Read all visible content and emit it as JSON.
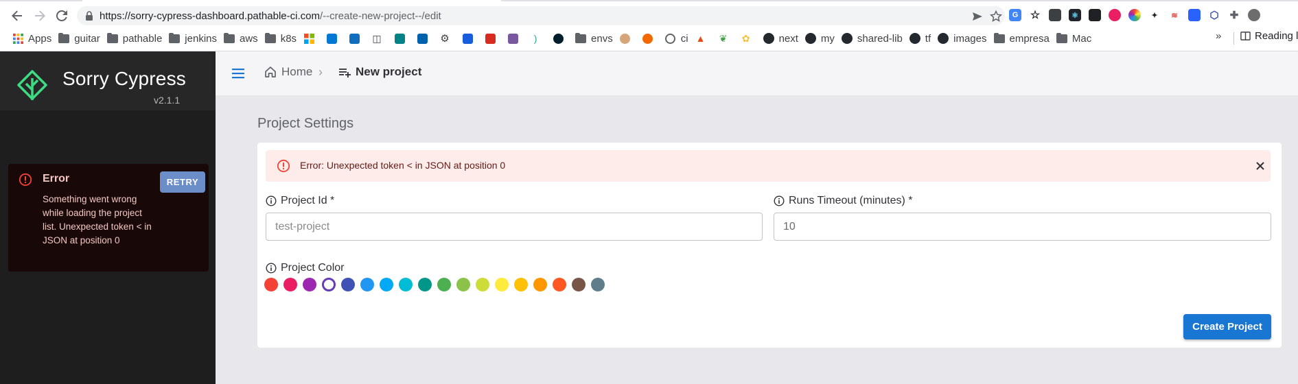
{
  "browser": {
    "url_host": "https://sorry-cypress-dashboard.pathable-ci.com",
    "url_path": "/--create-new-project--/edit",
    "bookmarks": [
      {
        "label": "Apps",
        "icon": "apps-grid-icon",
        "color": "#e8453c"
      },
      {
        "label": "guitar",
        "icon": "folder-icon"
      },
      {
        "label": "pathable",
        "icon": "folder-icon"
      },
      {
        "label": "jenkins",
        "icon": "folder-icon"
      },
      {
        "label": "aws",
        "icon": "folder-icon"
      },
      {
        "label": "k8s",
        "icon": "folder-icon"
      }
    ],
    "bookmarks_more": [
      {
        "label": "envs",
        "icon": "folder-icon"
      },
      {
        "label": "ci",
        "icon": "globe-icon"
      },
      {
        "label": "next",
        "icon": "github-icon"
      },
      {
        "label": "my",
        "icon": "github-icon"
      },
      {
        "label": "shared-lib",
        "icon": "github-icon"
      },
      {
        "label": "tf",
        "icon": "github-icon"
      },
      {
        "label": "images",
        "icon": "github-icon"
      },
      {
        "label": "empresa",
        "icon": "folder-icon"
      },
      {
        "label": "Mac",
        "icon": "folder-icon"
      }
    ],
    "overflow_label": "»",
    "reading_list_label": "Reading l"
  },
  "app": {
    "brand": "Sorry Cypress",
    "version": "v2.1.1",
    "accent_color": "#3ddc84",
    "sidebar_error": {
      "title": "Error",
      "message": "Something went wrong while loading the project list. Unexpected token < in JSON at position 0",
      "retry_label": "RETRY"
    },
    "breadcrumb": {
      "home": "Home",
      "separator": "›",
      "current": "New project"
    }
  },
  "form": {
    "section_title": "Project Settings",
    "alert_message": "Error: Unexpected token < in JSON at position 0",
    "project_id_label": "Project Id *",
    "project_id_placeholder": "test-project",
    "timeout_label": "Runs Timeout (minutes) *",
    "timeout_value": "10",
    "color_label": "Project Color",
    "colors": [
      "#f44336",
      "#e91e63",
      "#9c27b0",
      "#673ab7",
      "#3f51b5",
      "#2196f3",
      "#03a9f4",
      "#00bcd4",
      "#009688",
      "#4caf50",
      "#8bc34a",
      "#cddc39",
      "#ffeb3b",
      "#ffc107",
      "#ff9800",
      "#ff5722",
      "#795548",
      "#607d8b"
    ],
    "selected_color_index": 3,
    "submit_label": "Create Project"
  }
}
